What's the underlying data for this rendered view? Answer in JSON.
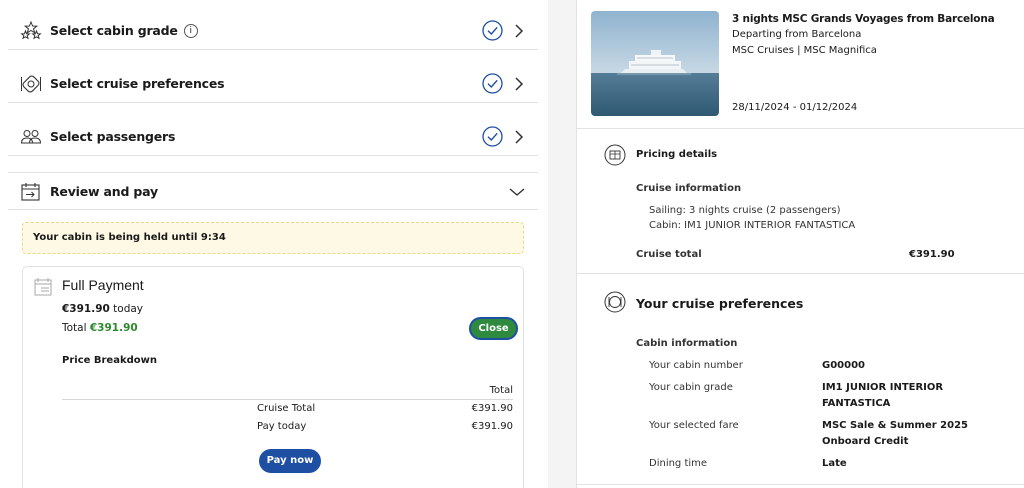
{
  "steps": [
    {
      "label": "Select cabin grade",
      "info": "i",
      "icon": "stars-icon",
      "completed": true
    },
    {
      "label": "Select cruise preferences",
      "icon": "dining-icon",
      "completed": true
    },
    {
      "label": "Select passengers",
      "icon": "passengers-icon",
      "completed": true
    },
    {
      "label": "Review and pay",
      "icon": "calendar-icon",
      "expanded": true
    }
  ],
  "hold_notice": "Your cabin is being held until 9:34",
  "payment": {
    "title": "Full Payment",
    "today_amount": "€391.90",
    "today_suffix": "today",
    "total_label": "Total",
    "total_amount": "€391.90",
    "close_label": "Close",
    "breakdown_title": "Price Breakdown",
    "col_total": "Total",
    "rows": [
      {
        "label": "Cruise Total",
        "value": "€391.90"
      },
      {
        "label": "Pay today",
        "value": "€391.90"
      }
    ],
    "pay_now_label": "Pay now"
  },
  "voyage": {
    "title": "3 nights MSC Grands Voyages from Barcelona",
    "departure": "Departing from Barcelona",
    "line": "MSC Cruises | MSC Magnifica",
    "dates": "28/11/2024 - 01/12/2024"
  },
  "pricing": {
    "title": "Pricing details",
    "subtitle": "Cruise information",
    "sailing": "Sailing: 3 nights cruise (2 passengers)",
    "cabin": "Cabin: IM1 JUNIOR INTERIOR FANTASTICA",
    "total_label": "Cruise total",
    "total_value": "€391.90"
  },
  "preferences": {
    "title": "Your cruise preferences",
    "subtitle": "Cabin information",
    "rows": [
      {
        "label": "Your cabin number",
        "value": "G00000"
      },
      {
        "label": "Your cabin grade",
        "value": "IM1 JUNIOR INTERIOR FANTASTICA"
      },
      {
        "label": "Your selected fare",
        "value": "MSC Sale & Summer 2025 Onboard Credit"
      },
      {
        "label": "Dining time",
        "value": "Late"
      }
    ]
  },
  "colors": {
    "accent_blue": "#1e4fa3",
    "success_green": "#2d8a3e",
    "hold_bg": "#fdf9e4"
  }
}
